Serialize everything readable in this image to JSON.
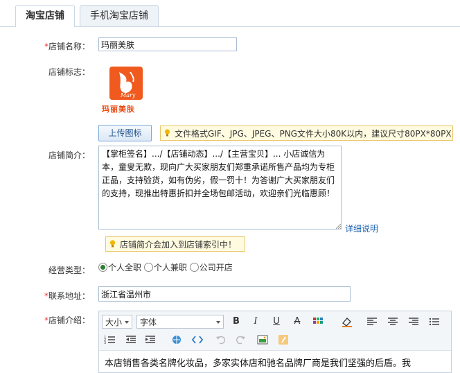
{
  "tabs": [
    {
      "label": "淘宝店铺",
      "active": true
    },
    {
      "label": "手机淘宝店铺",
      "active": false
    }
  ],
  "form": {
    "required_mark": "*",
    "shop_name": {
      "label": "店铺名称：",
      "value": "玛丽美肤"
    },
    "shop_logo": {
      "label": "店铺标志：",
      "logo_text": "玛丽美肤",
      "logo_script": "Mary",
      "upload_label": "上传图标",
      "tip": "文件格式GIF、JPG、JPEG、PNG文件大小80K以内，建议尺寸80PX*80PX"
    },
    "shop_intro": {
      "label": "店铺简介：",
      "value": "【掌柜签名】.../【店铺动态】.../【主营宝贝】... 小店诚信为本，童叟无欺，现向广大买家朋友们郑重承诺所售产品均为专柜正品，支持验货，如有伪劣，假一罚十！为答谢广大买家朋友们的支持，现推出特惠折扣并全场包邮活动，欢迎亲们光临惠顾！",
      "detail_link": "详细说明",
      "tip": "店铺简介会加入到店铺索引中！"
    },
    "business_type": {
      "label": "经营类型：",
      "options": [
        {
          "label": "个人全职",
          "selected": true
        },
        {
          "label": "个人兼职",
          "selected": false
        },
        {
          "label": "公司开店",
          "selected": false
        }
      ]
    },
    "address": {
      "label": "联系地址：",
      "value": "浙江省温州市"
    },
    "shop_desc": {
      "label": "店铺介绍：",
      "font_size": "大小",
      "font_family": "字体",
      "content": "本店销售各类名牌化妆品，多家实体店和驰名品牌厂商是我们坚强的后盾。我"
    }
  },
  "colors": {
    "accent": "#1e64b4",
    "required": "#e4393c",
    "tip_bg": "#fffbe0",
    "logo_bg": "#f05a1e"
  }
}
